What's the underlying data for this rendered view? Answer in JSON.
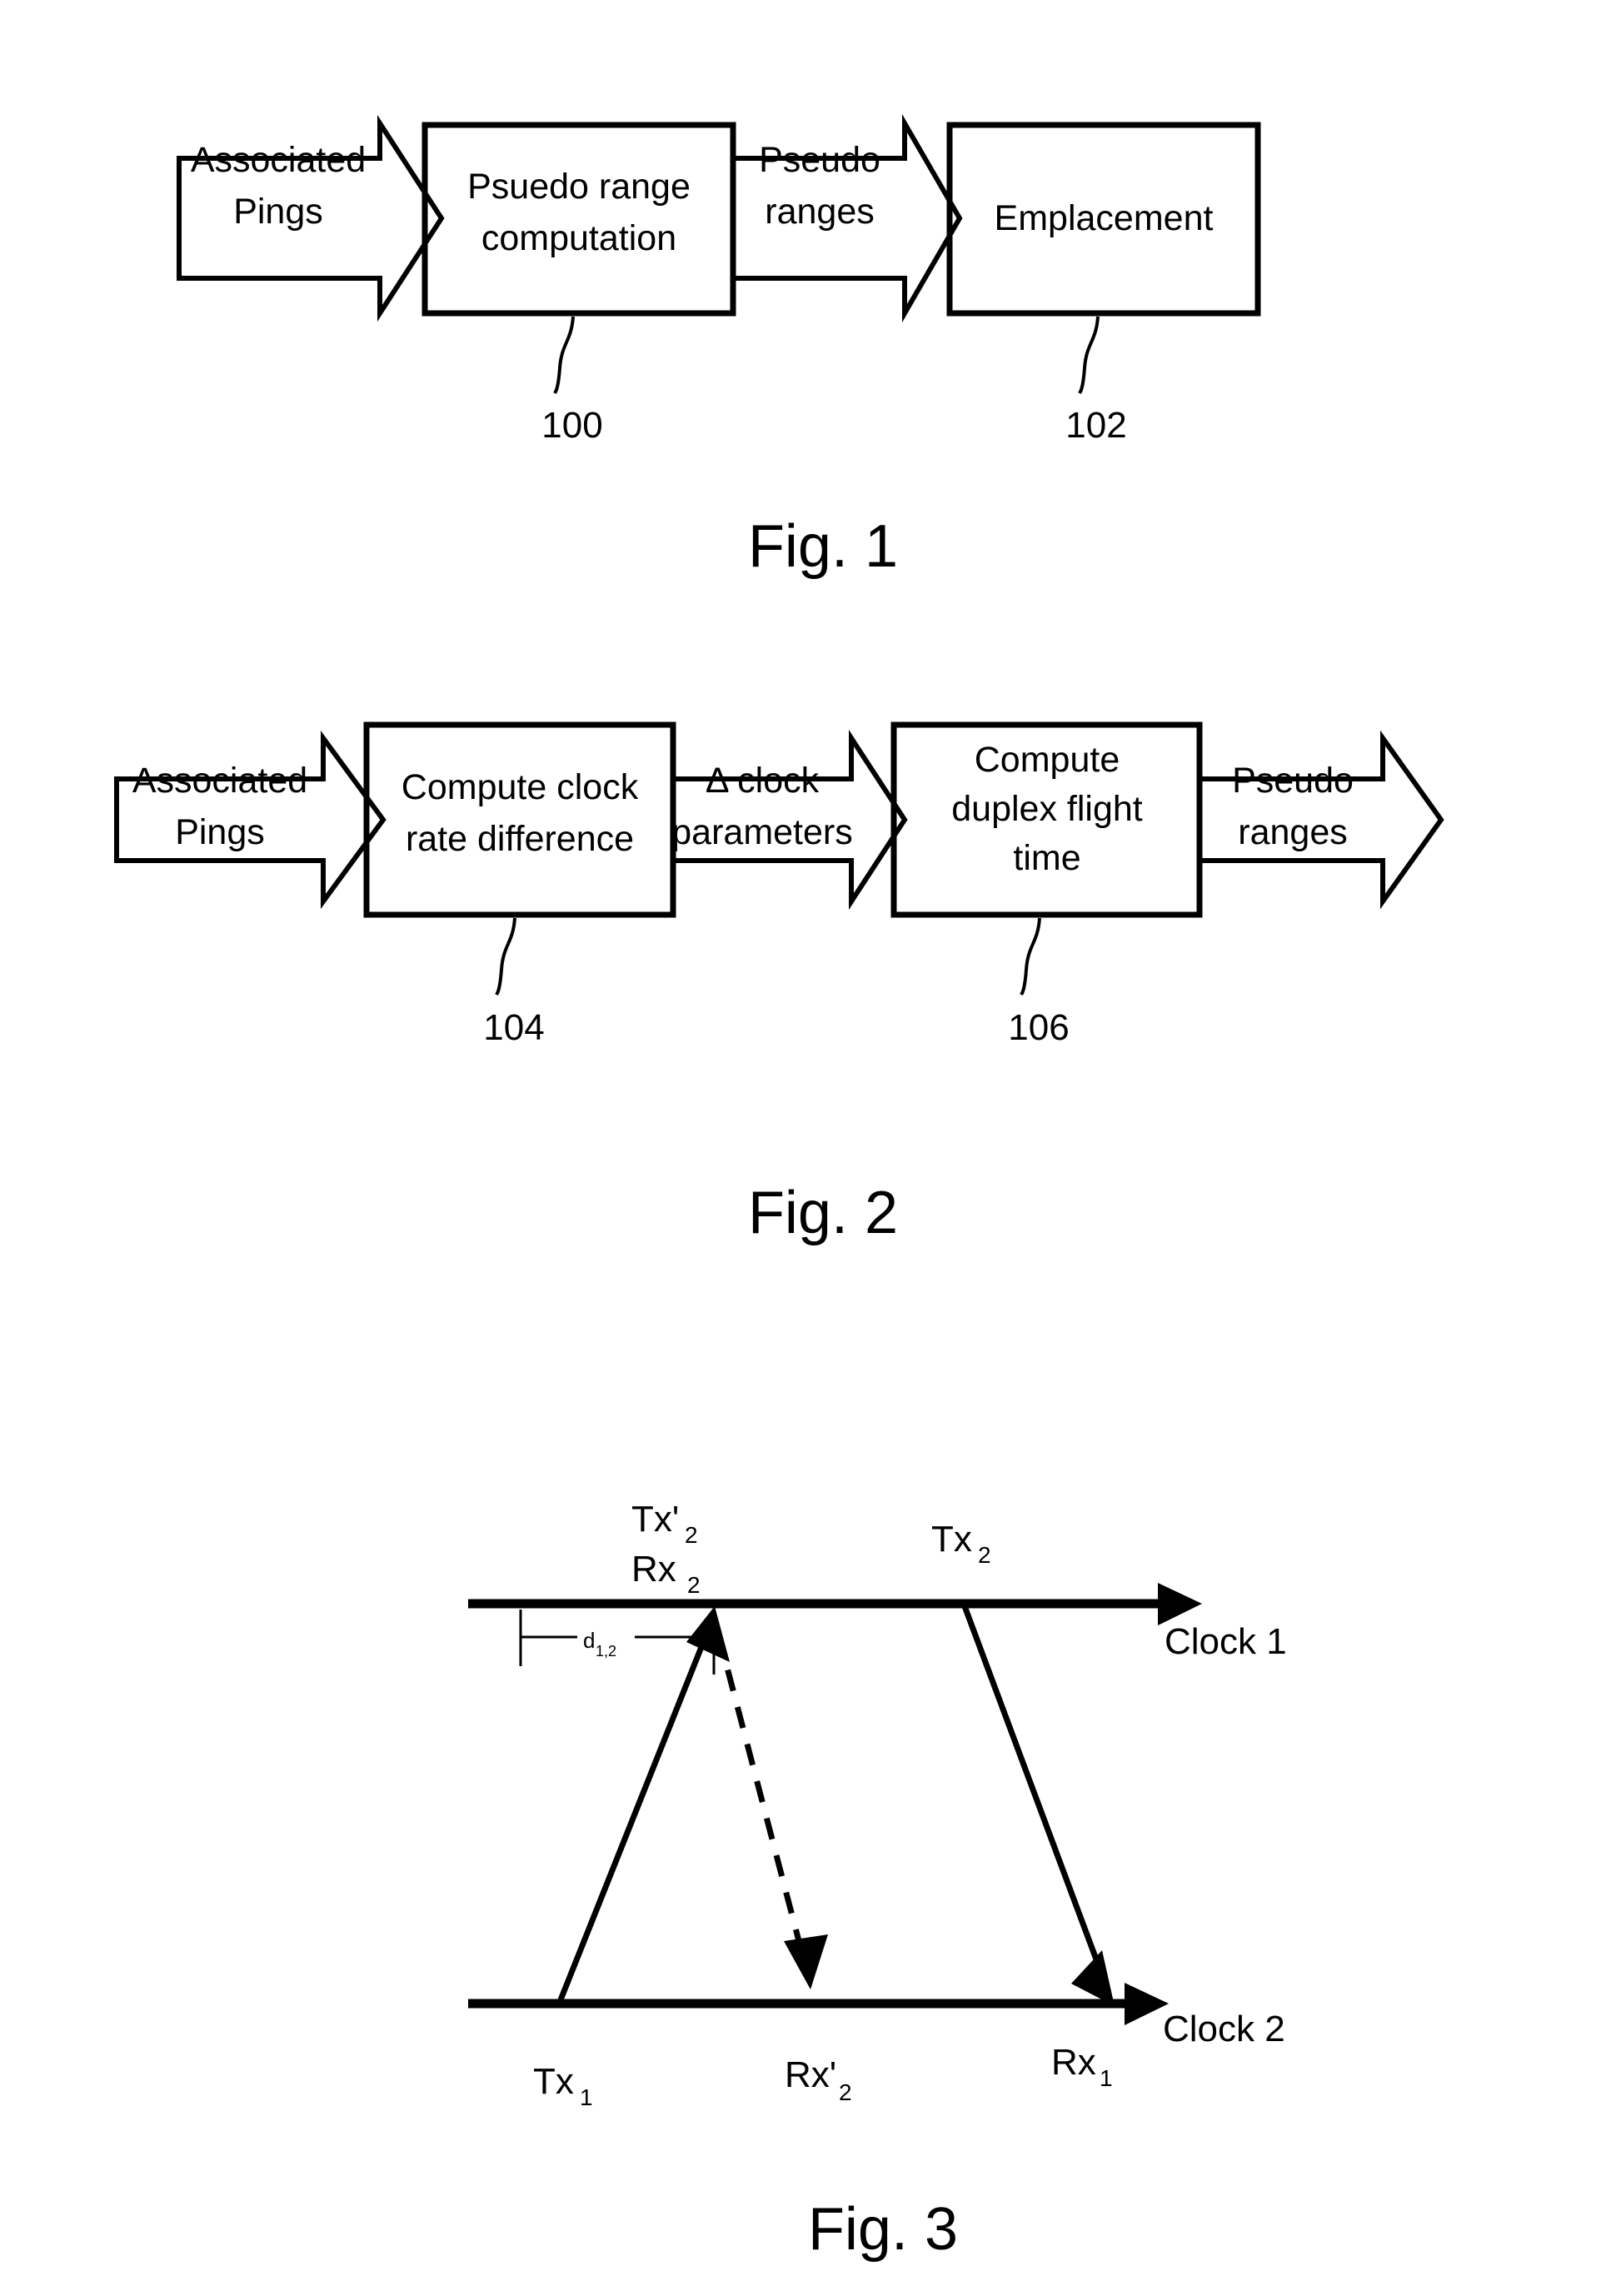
{
  "document": {
    "type": "patent-drawing-sheet",
    "background_color": "#ffffff",
    "ink_color": "#000000"
  },
  "figures": [
    {
      "id": "fig1",
      "caption": "Fig. 1",
      "blocks": [
        {
          "ref": "100",
          "lines": [
            "Psuedo range",
            "computation"
          ]
        },
        {
          "ref": "102",
          "lines": [
            "Emplacement"
          ]
        }
      ],
      "arrows": [
        {
          "lines": [
            "Associated",
            "Pings"
          ]
        },
        {
          "lines": [
            "Pseudo",
            "ranges"
          ]
        }
      ]
    },
    {
      "id": "fig2",
      "caption": "Fig. 2",
      "blocks": [
        {
          "ref": "104",
          "lines": [
            "Compute clock",
            "rate difference"
          ]
        },
        {
          "ref": "106",
          "lines": [
            "Compute",
            "duplex flight",
            "time"
          ]
        }
      ],
      "arrows": [
        {
          "lines": [
            "Associated",
            "Pings"
          ]
        },
        {
          "lines": [
            "Δ clock",
            "parameters"
          ]
        },
        {
          "lines": [
            "Pseudo",
            "ranges"
          ]
        }
      ]
    },
    {
      "id": "fig3",
      "caption": "Fig. 3",
      "axes": [
        {
          "name": "clock1",
          "label": "Clock 1"
        },
        {
          "name": "clock2",
          "label": "Clock 2"
        }
      ],
      "events": [
        {
          "name": "tx2prime",
          "base": "Tx'",
          "sub": "2",
          "axis": "clock1",
          "position": "above"
        },
        {
          "name": "rx2",
          "base": "Rx",
          "sub": "2",
          "axis": "clock1",
          "position": "above"
        },
        {
          "name": "tx2",
          "base": "Tx",
          "sub": "2",
          "axis": "clock1",
          "position": "above"
        },
        {
          "name": "tx1",
          "base": "Tx",
          "sub": "1",
          "axis": "clock2",
          "position": "below"
        },
        {
          "name": "rx2prime",
          "base": "Rx'",
          "sub": "2",
          "axis": "clock2",
          "position": "below"
        },
        {
          "name": "rx1",
          "base": "Rx",
          "sub": "1",
          "axis": "clock2",
          "position": "below"
        }
      ],
      "dimension": {
        "base": "d",
        "sub": "1,2"
      }
    }
  ]
}
